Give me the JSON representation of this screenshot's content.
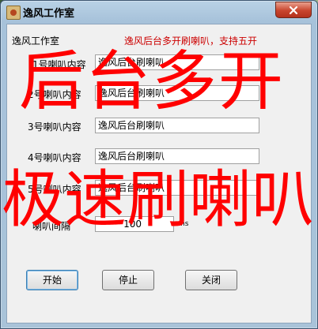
{
  "window": {
    "title": "逸风工作室",
    "close_glyph": "✕"
  },
  "header": {
    "studio_label": "逸风工作室",
    "promo_text": "逸风后台多开刷喇叭，支持五开"
  },
  "rows": [
    {
      "label": "1号喇叭内容",
      "value": "逸风后台刷喇叭"
    },
    {
      "label": "2号喇叭内容",
      "value": "逸风后台刷喇叭"
    },
    {
      "label": "3号喇叭内容",
      "value": "逸风后台刷喇叭"
    },
    {
      "label": "4号喇叭内容",
      "value": "逸风后台刷喇叭"
    },
    {
      "label": "5号喇叭内容",
      "value": "逸风后台刷喇叭"
    }
  ],
  "interval": {
    "label": "喇叭间隔",
    "value": "100",
    "unit": "ms"
  },
  "buttons": {
    "start": "开始",
    "stop": "停止",
    "close": "关闭"
  },
  "overlay": {
    "line1": "后台多开",
    "line2": "极速刷喇叭"
  }
}
